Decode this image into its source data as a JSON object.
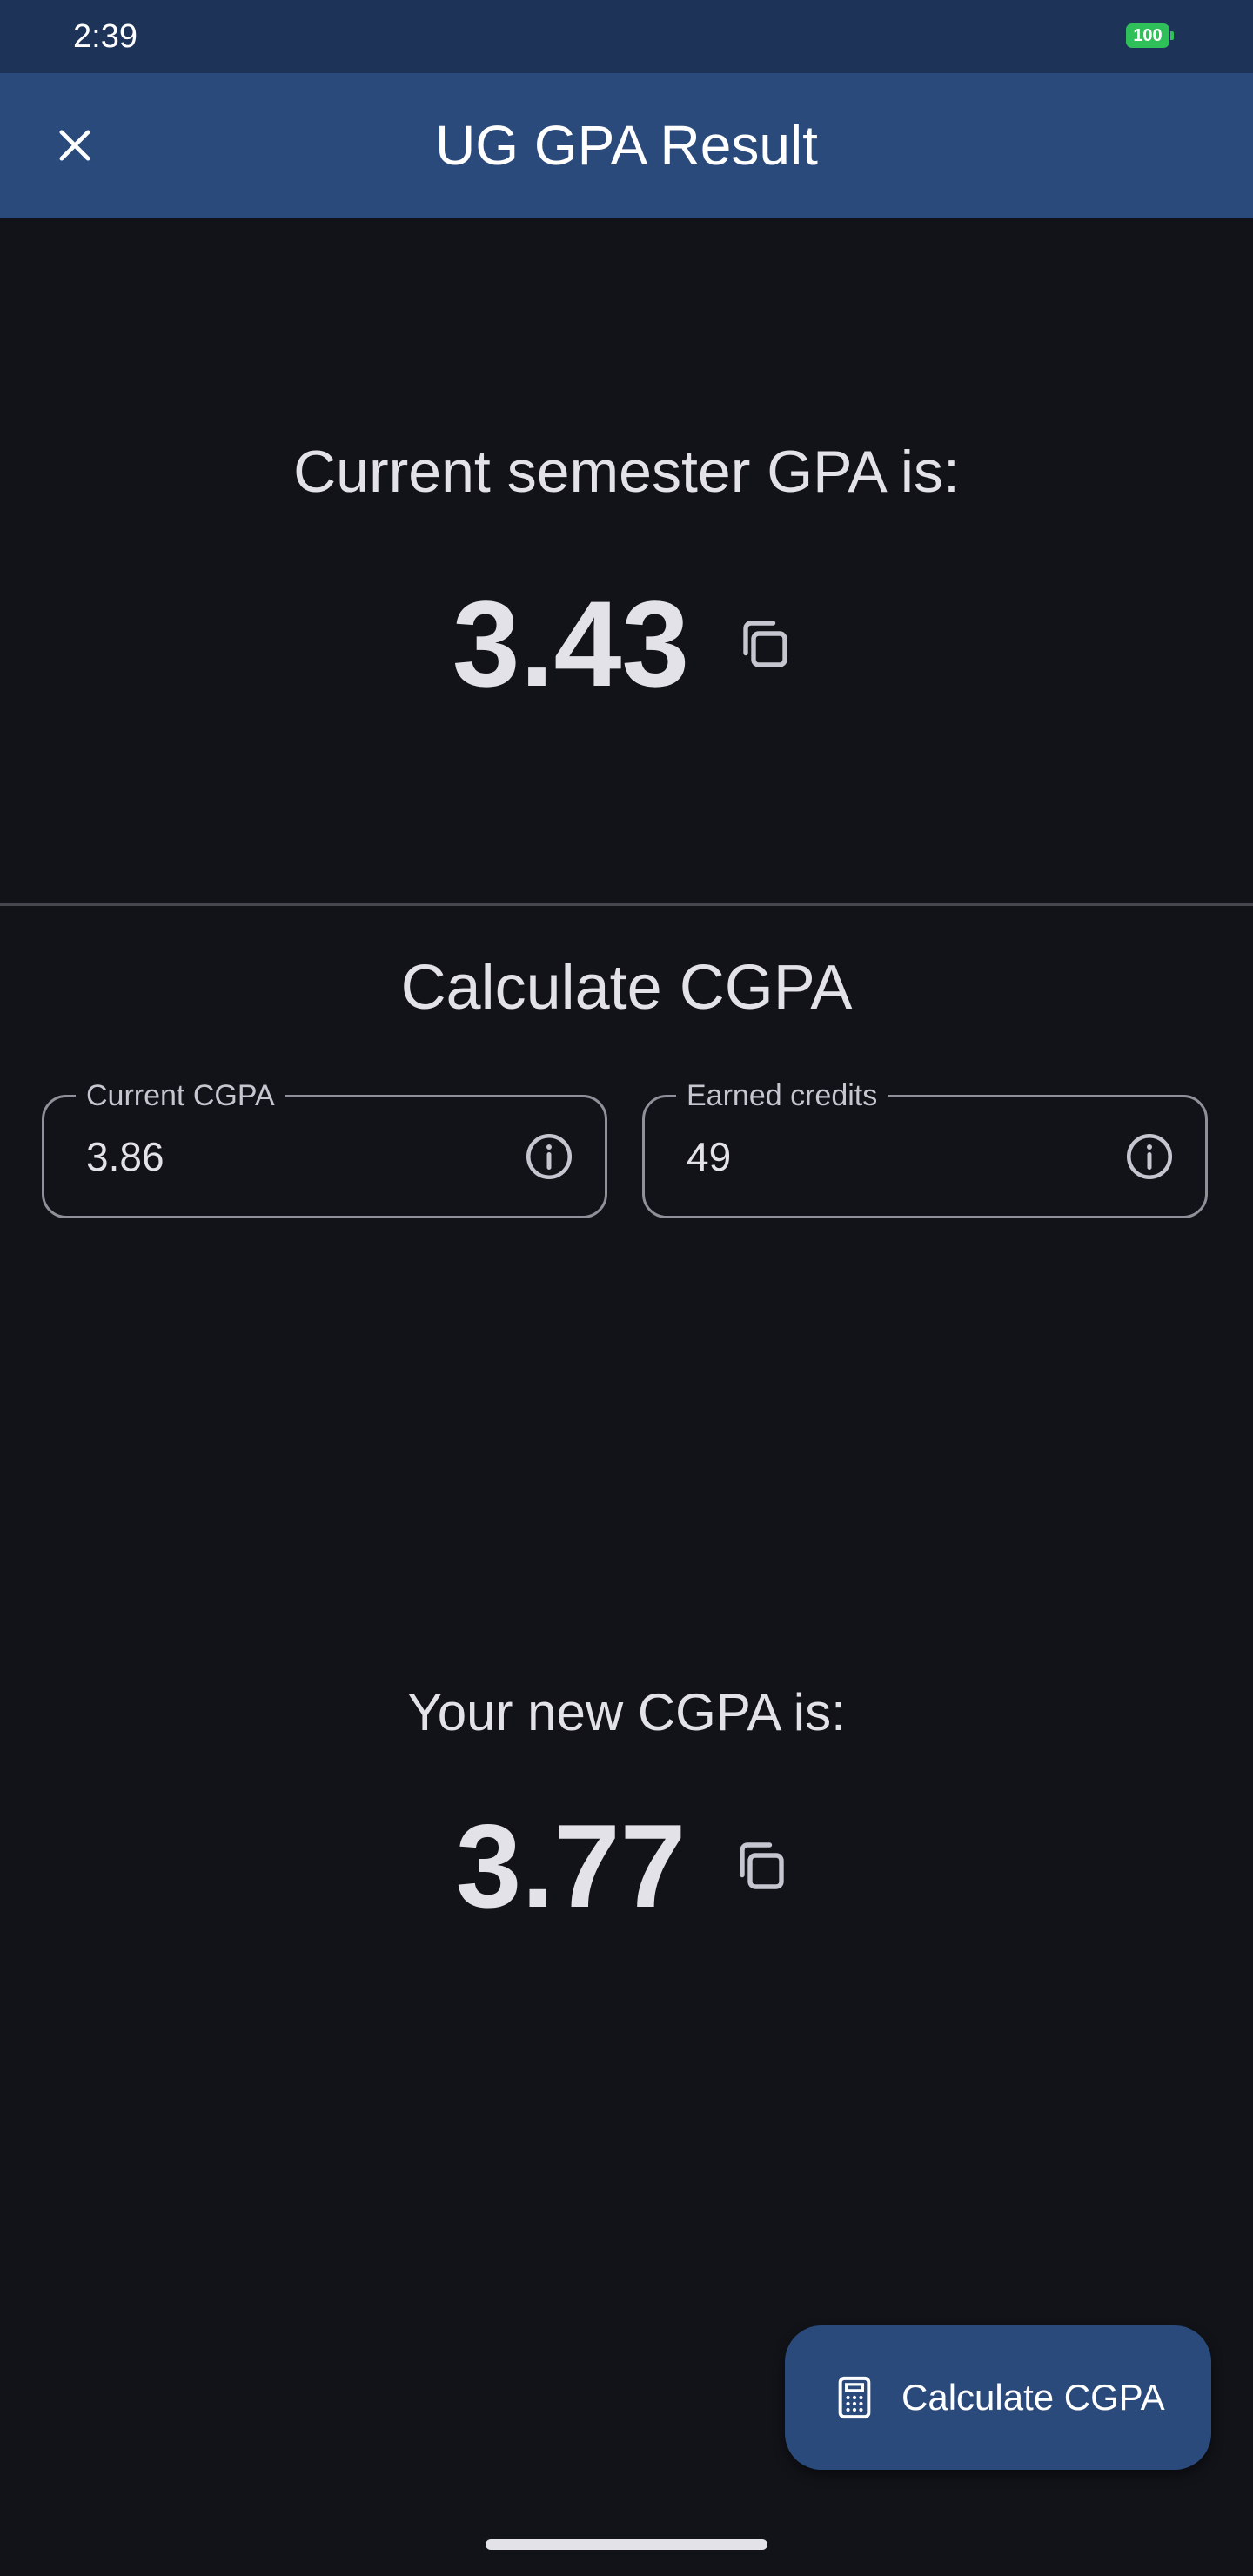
{
  "status_bar": {
    "time": "2:39",
    "battery": "100",
    "battery_color": "#2fc05a"
  },
  "app_bar": {
    "title": "UG GPA Result",
    "close_icon": "close-icon",
    "background": "#2a4a7c"
  },
  "semester": {
    "heading": "Current semester GPA is:",
    "gpa": "3.43",
    "copy_icon": "copy-icon"
  },
  "cgpa_section": {
    "heading": "Calculate CGPA",
    "fields": [
      {
        "label": "Current CGPA",
        "value": "3.86",
        "icon": "info-icon"
      },
      {
        "label": "Earned credits",
        "value": "49",
        "icon": "info-icon"
      }
    ]
  },
  "result": {
    "heading": "Your new CGPA is:",
    "cgpa": "3.77",
    "copy_icon": "copy-icon"
  },
  "fab": {
    "label": "Calculate CGPA",
    "icon": "calculator-icon"
  },
  "theme": {
    "background": "#121318",
    "text": "#e3e2e8",
    "outline": "#8f9099"
  }
}
